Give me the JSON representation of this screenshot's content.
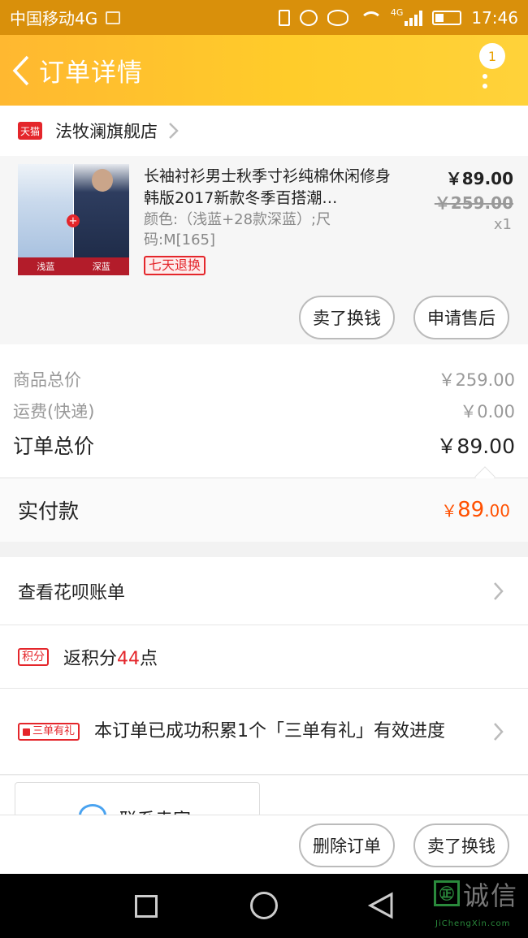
{
  "status_bar": {
    "carrier": "中国移动4G",
    "network": "4G",
    "time": "17:46"
  },
  "header": {
    "title": "订单详情",
    "badge_count": "1"
  },
  "store": {
    "platform_tag": "天猫",
    "name": "法牧澜旗舰店"
  },
  "product": {
    "title": "长袖衬衫男士秋季寸衫纯棉休闲修身韩版2017新款冬季百搭潮…",
    "spec": "颜色:（浅蓝+28款深蓝）;尺码:M[165]",
    "return_tag": "七天退换",
    "price_now": "￥89.00",
    "price_old": "￥259.00",
    "quantity": "x1",
    "image_labels": [
      "浅蓝",
      "深蓝"
    ],
    "actions": {
      "sell": "卖了换钱",
      "after_sale": "申请售后"
    }
  },
  "summary": {
    "goods_total_label": "商品总价",
    "goods_total_value": "￥259.00",
    "shipping_label": "运费(快递)",
    "shipping_value": "￥0.00",
    "order_total_label": "订单总价",
    "order_total_value": "￥89.00",
    "paid_label": "实付款",
    "paid_currency": "￥",
    "paid_integer": "89",
    "paid_decimal": ".00"
  },
  "rows": {
    "huabei": "查看花呗账单",
    "points_tag": "积分",
    "points_prefix": "返积分",
    "points_value": "44",
    "points_suffix": "点",
    "three_tag": "三单有礼",
    "three_text": "本订单已成功积累1个「三单有礼」有效进度"
  },
  "contact": {
    "label": "联系卖家"
  },
  "bottom_bar": {
    "delete": "删除订单",
    "sell": "卖了换钱"
  },
  "watermark": {
    "logo": "㊣",
    "text": "诚信",
    "sub": "JiChengXin.com"
  },
  "colors": {
    "header_gradient_start": "#ffb830",
    "header_gradient_end": "#ffd23a",
    "accent_red": "#e4262b",
    "price_orange": "#ff5000"
  },
  "icons": [
    "back-arrow-icon",
    "more-dots-icon",
    "tmall-icon",
    "chevron-right-icon",
    "chat-icon",
    "nav-recent-icon",
    "nav-home-icon",
    "nav-back-icon"
  ]
}
